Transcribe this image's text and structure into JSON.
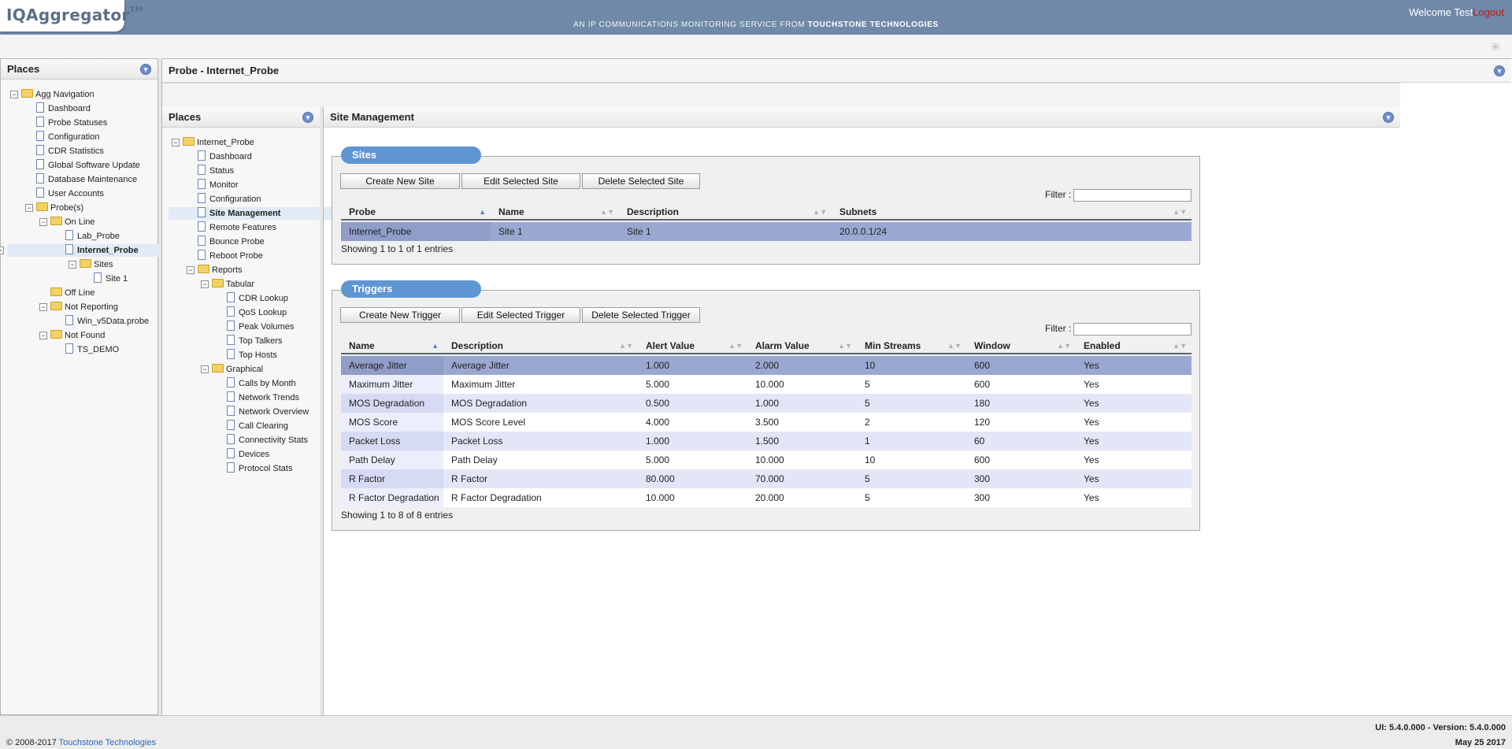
{
  "header": {
    "logo": "IQAggregator",
    "logo_tm": "TM",
    "tagline_prefix": "AN IP COMMUNICATIONS MONITORING SERVICE FROM",
    "tagline_brand": "TOUCHSTONE TECHNOLOGIES",
    "welcome": "Welcome Test",
    "logout": "Logout"
  },
  "left_places": {
    "title": "Places",
    "items": [
      "Agg Navigation",
      "Dashboard",
      "Probe Statuses",
      "Configuration",
      "CDR Statistics",
      "Global Software Update",
      "Database Maintenance",
      "User Accounts",
      "Probe(s)",
      "On Line",
      "Lab_Probe",
      "Internet_Probe",
      "Sites",
      "Site 1",
      "Off Line",
      "Not Reporting",
      "Win_v5Data.probe",
      "Not Found",
      "TS_DEMO"
    ]
  },
  "probe_panel": {
    "title": "Probe - Internet_Probe"
  },
  "places2": {
    "title": "Places",
    "items": [
      "Internet_Probe",
      "Dashboard",
      "Status",
      "Monitor",
      "Configuration",
      "Site Management",
      "Remote Features",
      "Bounce Probe",
      "Reboot Probe",
      "Reports",
      "Tabular",
      "CDR Lookup",
      "QoS Lookup",
      "Peak Volumes",
      "Top Talkers",
      "Top Hosts",
      "Graphical",
      "Calls by Month",
      "Network Trends",
      "Network Overview",
      "Call Clearing",
      "Connectivity Stats",
      "Devices",
      "Protocol Stats"
    ]
  },
  "site_management": {
    "title": "Site Management",
    "sites": {
      "title": "Sites",
      "buttons": [
        "Create New Site",
        "Edit Selected Site",
        "Delete Selected Site"
      ],
      "filter_label": "Filter :",
      "columns": [
        "Probe",
        "Name",
        "Description",
        "Subnets"
      ],
      "rows": [
        [
          "Internet_Probe",
          "Site 1",
          "Site 1",
          "20.0.0.1/24"
        ]
      ],
      "info": "Showing 1 to 1 of 1 entries"
    },
    "triggers": {
      "title": "Triggers",
      "buttons": [
        "Create New Trigger",
        "Edit Selected Trigger",
        "Delete Selected Trigger"
      ],
      "filter_label": "Filter :",
      "columns": [
        "Name",
        "Description",
        "Alert Value",
        "Alarm Value",
        "Min Streams",
        "Window",
        "Enabled"
      ],
      "rows": [
        [
          "Average Jitter",
          "Average Jitter",
          "1.000",
          "2.000",
          "10",
          "600",
          "Yes"
        ],
        [
          "Maximum Jitter",
          "Maximum Jitter",
          "5.000",
          "10.000",
          "5",
          "600",
          "Yes"
        ],
        [
          "MOS Degradation",
          "MOS Degradation",
          "0.500",
          "1.000",
          "5",
          "180",
          "Yes"
        ],
        [
          "MOS Score",
          "MOS Score Level",
          "4.000",
          "3.500",
          "2",
          "120",
          "Yes"
        ],
        [
          "Packet Loss",
          "Packet Loss",
          "1.000",
          "1.500",
          "1",
          "60",
          "Yes"
        ],
        [
          "Path Delay",
          "Path Delay",
          "5.000",
          "10.000",
          "10",
          "600",
          "Yes"
        ],
        [
          "R Factor",
          "R Factor",
          "80.000",
          "70.000",
          "5",
          "300",
          "Yes"
        ],
        [
          "R Factor Degradation",
          "R Factor Degradation",
          "10.000",
          "20.000",
          "5",
          "300",
          "Yes"
        ]
      ],
      "info": "Showing 1 to 8 of 8 entries"
    }
  },
  "footer": {
    "copyright_prefix": "© 2008-2017",
    "company": "Touchstone Technologies",
    "version": "UI: 5.4.0.000 - Version: 5.4.0.000",
    "date": "May 25 2017"
  },
  "colors": {
    "header": "#7089a8",
    "group_title": "#5f95d3",
    "selected_row": "#9aa8d1",
    "logout": "#c21a1a"
  },
  "icons": {
    "folder": "folder-icon",
    "document": "document-icon",
    "collapse": "collapse-icon",
    "spinner": "loading-icon"
  }
}
